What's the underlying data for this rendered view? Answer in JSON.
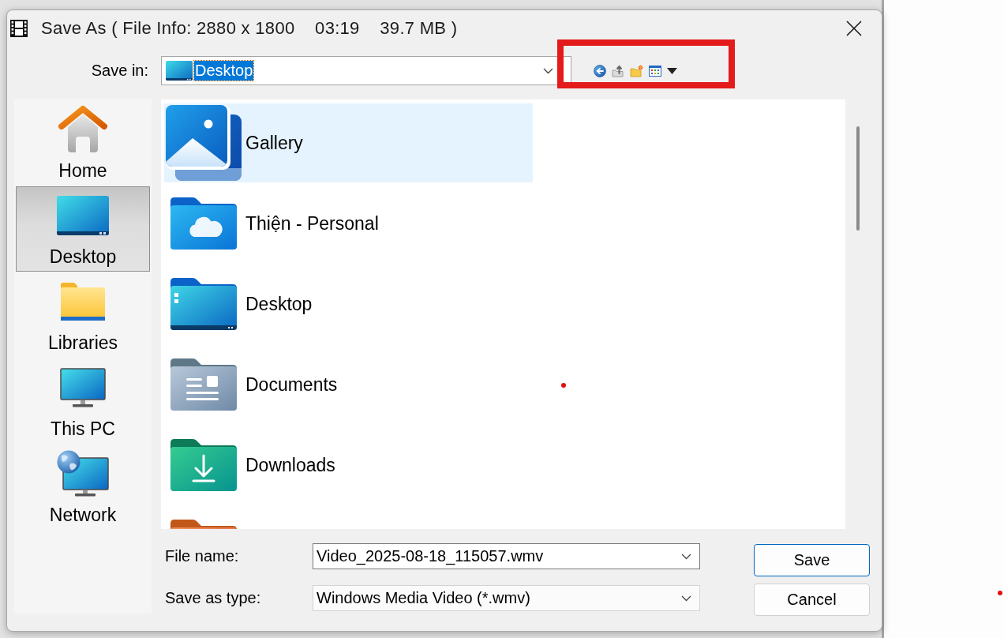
{
  "window": {
    "title": "Save As ( File Info: 2880 x 1800    03:19    39.7 MB )"
  },
  "save_in": {
    "label": "Save in:",
    "value": "Desktop",
    "text_selected": true
  },
  "places": [
    {
      "kind": "home",
      "label": "Home",
      "selected": false
    },
    {
      "kind": "desktop",
      "label": "Desktop",
      "selected": true
    },
    {
      "kind": "libraries",
      "label": "Libraries",
      "selected": false
    },
    {
      "kind": "computer",
      "label": "This PC",
      "selected": false
    },
    {
      "kind": "network",
      "label": "Network",
      "selected": false
    }
  ],
  "files": [
    {
      "kind": "gallery",
      "label": "Gallery",
      "selected": true
    },
    {
      "kind": "cloud-folder",
      "label": "Thiện - Personal",
      "selected": false
    },
    {
      "kind": "desktop-folder",
      "label": "Desktop",
      "selected": false
    },
    {
      "kind": "documents-folder",
      "label": "Documents",
      "selected": false
    },
    {
      "kind": "downloads-folder",
      "label": "Downloads",
      "selected": false
    },
    {
      "kind": "folder",
      "selected": false
    }
  ],
  "file_name": {
    "label": "File name:",
    "value": "Video_2025-08-18_115057.wmv"
  },
  "save_as_type": {
    "label": "Save as type:",
    "value": "Windows Media Video (*.wmv)"
  },
  "buttons": [
    {
      "label": "Save",
      "default": true
    },
    {
      "label": "Cancel",
      "default": false
    }
  ]
}
